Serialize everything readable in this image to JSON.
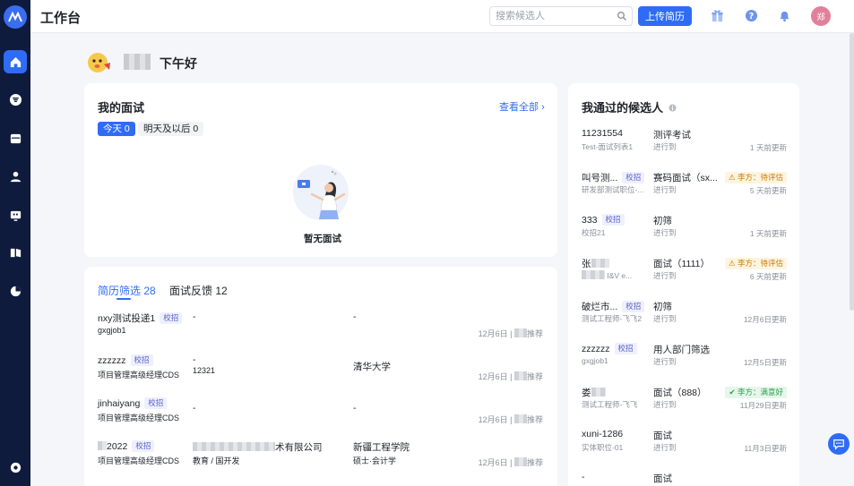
{
  "header": {
    "title": "工作台",
    "search_placeholder": "搜索候选人",
    "upload_label": "上传简历",
    "avatar_text": "郑"
  },
  "greeting": {
    "text": "下午好"
  },
  "interviews": {
    "title": "我的面试",
    "view_all": "查看全部",
    "today": "今天 0",
    "later": "明天及以后 0",
    "empty": "暂无面试"
  },
  "screening": {
    "tabs": [
      {
        "label": "简历筛选 28"
      },
      {
        "label": "面试反馈 12"
      }
    ],
    "rows": [
      {
        "name": "nxy测试投递1",
        "tag": "校招",
        "sub": "gxgjob1",
        "c2": "-",
        "c2s": "",
        "c3": "-",
        "c3s": "",
        "date": "12月6日 |",
        "suffix": "推荐"
      },
      {
        "name": "zzzzzz",
        "tag": "校招",
        "sub": "项目管理高级经理CDS",
        "c2": "-",
        "c2s": "12321",
        "c3": "清华大学",
        "c3s": "",
        "date": "12月6日 |",
        "suffix": "推荐"
      },
      {
        "name": "jinhaiyang",
        "tag": "校招",
        "sub": "项目管理高级经理CDS",
        "c2": "-",
        "c2s": "",
        "c3": "-",
        "c3s": "",
        "date": "12月6日 |",
        "suffix": "推荐"
      },
      {
        "name": "2022",
        "tag": "校招",
        "sub": "项目管理高级经理CDS",
        "c2": "术有限公司",
        "c2s": "教育 / 国开发",
        "c3": "新疆工程学院",
        "c3s": "硕士·会计学",
        "date": "12月6日 |",
        "suffix": "推荐"
      }
    ]
  },
  "passed": {
    "title": "我通过的候选人",
    "rows": [
      {
        "name": "11231554",
        "tag": "",
        "sub": "Test-面试列表1",
        "stage": "测评考试",
        "stage_sub": "进行到",
        "badge": "",
        "badge_type": "",
        "update": "1 天前更新"
      },
      {
        "name": "叫号测...",
        "tag": "校招",
        "sub": "研发部测试职位-...",
        "stage": "赛码面试（sx...",
        "stage_sub": "进行到",
        "badge": "李方：待评估",
        "badge_type": "warn",
        "update": "5 天前更新"
      },
      {
        "name": "333",
        "tag": "校招",
        "sub": "校招21",
        "stage": "初筛",
        "stage_sub": "进行到",
        "badge": "",
        "badge_type": "",
        "update": "1 天前更新"
      },
      {
        "name": "张",
        "tag": "",
        "sub": "I&V e...",
        "stage": "面试（1111）",
        "stage_sub": "进行到",
        "badge": "李方：待评估",
        "badge_type": "warn",
        "update": "6 天前更新"
      },
      {
        "name": "破烂市...",
        "tag": "校招",
        "sub": "测试工程师-飞飞2",
        "stage": "初筛",
        "stage_sub": "进行到",
        "badge": "",
        "badge_type": "",
        "update": "12月6日更新"
      },
      {
        "name": "zzzzzz",
        "tag": "校招",
        "sub": "gxgjob1",
        "stage": "用人部门筛选",
        "stage_sub": "进行到",
        "badge": "",
        "badge_type": "",
        "update": "12月5日更新"
      },
      {
        "name": "娄",
        "tag": "",
        "sub": "测试工程师-飞飞",
        "stage": "面试（888）",
        "stage_sub": "进行到",
        "badge": "李方：满意好",
        "badge_type": "good",
        "update": "11月29日更新"
      },
      {
        "name": "xuni-1286",
        "tag": "",
        "sub": "实体职位-01",
        "stage": "面试",
        "stage_sub": "进行到",
        "badge": "",
        "badge_type": "",
        "update": "11月3日更新"
      },
      {
        "name": "-",
        "tag": "",
        "sub": "",
        "stage": "面试",
        "stage_sub": "",
        "badge": "",
        "badge_type": "",
        "update": ""
      }
    ]
  }
}
